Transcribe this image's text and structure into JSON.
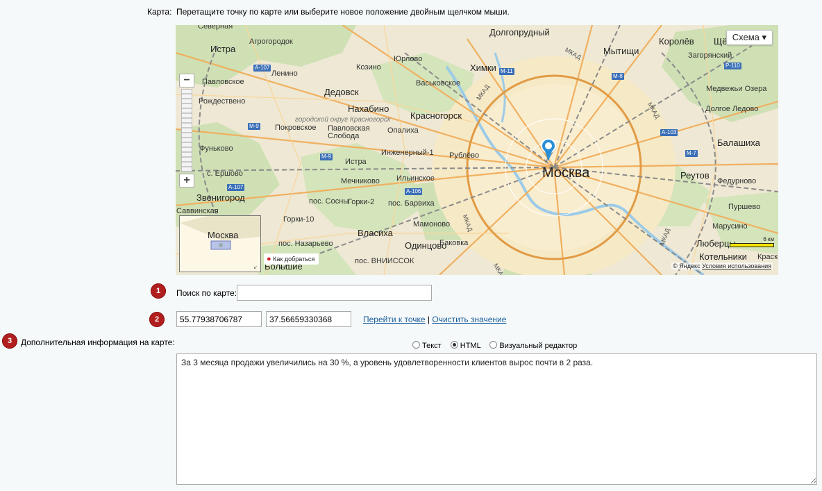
{
  "map_row": {
    "label": "Карта:",
    "hint": "Перетащите точку по карте или выберите новое положение двойным щелчком мыши."
  },
  "map": {
    "layer_button": "Схема ▾",
    "zoom_in": "+",
    "zoom_out": "−",
    "route_button": "Как добраться",
    "scale_label": "6 км",
    "copyright": "© Яндекс",
    "terms_link": "Условия использования",
    "minimap_label": "Москва",
    "labels": {
      "moscow": "Москва",
      "dolgoprudny": "Долгопрудный",
      "khimki": "Химки",
      "mytishchi": "Мытищи",
      "korolev": "Королёв",
      "shchyo": "Щё",
      "zagoryansky": "Загорянский",
      "istra": "Истра",
      "agrogorodok": "Агрогородок",
      "severnaya": "Северная",
      "dedovsk": "Дедовск",
      "nakhabino": "Нахабино",
      "krasnogorsk": "Красногорск",
      "opalikha": "Опалиха",
      "inzhenerny": "Инженерный-1",
      "rublevo": "Рублёво",
      "balashikha": "Балашиха",
      "reutov": "Реутов",
      "fedurnovo": "Федурново",
      "purshevo": "Пуршево",
      "marusino": "Марусино",
      "lyubertsy": "Люберцы",
      "kotelniki": "Котельники",
      "kraskovo": "Красково",
      "zvenigorod": "Звенигород",
      "vlasikha": "Власиха",
      "odintsovo": "Одинцово",
      "bakovka": "Баковка",
      "mamonovo": "Мамоново",
      "gorki2": "Горки-2",
      "gorki10": "Горки-10",
      "sosny": "пос. Сосны",
      "barvikha": "пос. Барвиха",
      "ilyinskoe": "Ильинское",
      "mechnikovo": "Мечниково",
      "yershovo": "с. Ершово",
      "funkovo": "Фуньково",
      "pokrovskoe": "Покровское",
      "pavlovskaya": "Павловская Слобода",
      "rozhdestveno": "Рождествено",
      "pavlovskoe": "Павловское",
      "lenino": "Ленино",
      "kozino": "Козино",
      "yurlovo": "Юрлово",
      "vaskovskoe": "Васьковское",
      "nazarevo": "пос. Назарьево",
      "vniissok": "пос. ВНИИССОК",
      "savvinskaya": "Саввинская",
      "bolshie": "Большие",
      "medvezhi": "Медвежьи Озера",
      "dolgoe": "Долгое Ледово",
      "krasnogorsky_okrug": "городской округ Красногорск",
      "istra2": "Истра",
      "mkad": "МКАД",
      "korolev_road": "Королёв"
    },
    "highways": {
      "a107_top": "A-107",
      "m9": "M-9",
      "m9b": "M-9",
      "a107_bottom": "A-107",
      "m11": "M-11",
      "m8": "M-8",
      "a103": "A-103",
      "m7": "M-7",
      "p110": "P-110",
      "a106": "A-106"
    }
  },
  "search": {
    "badge": "1",
    "label": "Поиск по карте:",
    "value": "",
    "placeholder": ""
  },
  "coords": {
    "badge": "2",
    "lat": "55.77938706787",
    "lon": "37.56659330368",
    "go_link": "Перейти к точке",
    "separator": "|",
    "clear_link": "Очистить значение"
  },
  "extra_info": {
    "badge": "3",
    "label": "Дополнительная информация на карте:",
    "modes": {
      "text": "Текст",
      "html": "HTML",
      "visual": "Визуальный редактор"
    },
    "selected_mode": "html",
    "content": "За 3 месяца продажи увеличились на 30 %, а уровень удовлетворенности клиентов вырос почти в 2 раза."
  },
  "colors": {
    "badge": "#b01e1e",
    "link": "#1a5d9c",
    "map_pin": "#2a8fd6"
  }
}
